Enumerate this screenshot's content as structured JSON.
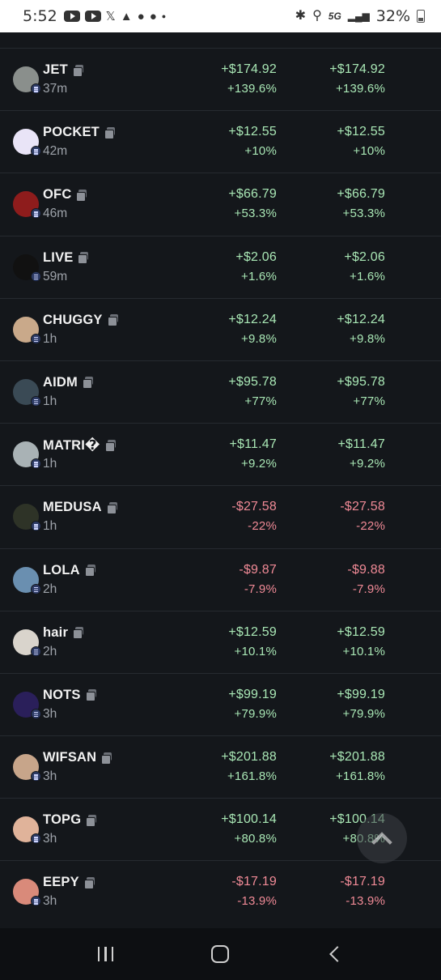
{
  "status_bar": {
    "time": "5:52",
    "network": "5G",
    "battery": "32%",
    "left_icons": [
      "youtube-icon",
      "youtube-icon",
      "x-icon",
      "arrow-app-icon",
      "reddit-icon",
      "reddit-icon",
      "dot-icon"
    ],
    "right_icons": [
      "bluetooth-icon",
      "location-icon",
      "5g-icon",
      "signal-icon",
      "battery-icon"
    ]
  },
  "rows": [
    {
      "name": "JET",
      "age": "37m",
      "val1": "+$174.92",
      "pct1": "+139.6%",
      "val2": "+$174.92",
      "pct2": "+139.6%",
      "trend": "pos",
      "avatar_color": "#8a8f8c"
    },
    {
      "name": "POCKET",
      "age": "42m",
      "val1": "+$12.55",
      "pct1": "+10%",
      "val2": "+$12.55",
      "pct2": "+10%",
      "trend": "pos",
      "avatar_color": "#e9e4f7"
    },
    {
      "name": "OFC",
      "age": "46m",
      "val1": "+$66.79",
      "pct1": "+53.3%",
      "val2": "+$66.79",
      "pct2": "+53.3%",
      "trend": "pos",
      "avatar_color": "#8e1c1c"
    },
    {
      "name": "LIVE",
      "age": "59m",
      "val1": "+$2.06",
      "pct1": "+1.6%",
      "val2": "+$2.06",
      "pct2": "+1.6%",
      "trend": "pos",
      "avatar_color": "#111111"
    },
    {
      "name": "CHUGGY",
      "age": "1h",
      "val1": "+$12.24",
      "pct1": "+9.8%",
      "val2": "+$12.24",
      "pct2": "+9.8%",
      "trend": "pos",
      "avatar_color": "#c9a98a"
    },
    {
      "name": "AIDM",
      "age": "1h",
      "val1": "+$95.78",
      "pct1": "+77%",
      "val2": "+$95.78",
      "pct2": "+77%",
      "trend": "pos",
      "avatar_color": "#3a4a55"
    },
    {
      "name": "MATRI�",
      "age": "1h",
      "val1": "+$11.47",
      "pct1": "+9.2%",
      "val2": "+$11.47",
      "pct2": "+9.2%",
      "trend": "pos",
      "avatar_color": "#a9b2b5"
    },
    {
      "name": "MEDUSA",
      "age": "1h",
      "val1": "-$27.58",
      "pct1": "-22%",
      "val2": "-$27.58",
      "pct2": "-22%",
      "trend": "neg",
      "avatar_color": "#2e3327"
    },
    {
      "name": "LOLA",
      "age": "2h",
      "val1": "-$9.87",
      "pct1": "-7.9%",
      "val2": "-$9.88",
      "pct2": "-7.9%",
      "trend": "neg",
      "avatar_color": "#6a8fb0"
    },
    {
      "name": "hair",
      "age": "2h",
      "val1": "+$12.59",
      "pct1": "+10.1%",
      "val2": "+$12.59",
      "pct2": "+10.1%",
      "trend": "pos",
      "avatar_color": "#d9d4cc"
    },
    {
      "name": "NOTS",
      "age": "3h",
      "val1": "+$99.19",
      "pct1": "+79.9%",
      "val2": "+$99.19",
      "pct2": "+79.9%",
      "trend": "pos",
      "avatar_color": "#2a1f5a"
    },
    {
      "name": "WIFSAN",
      "age": "3h",
      "val1": "+$201.88",
      "pct1": "+161.8%",
      "val2": "+$201.88",
      "pct2": "+161.8%",
      "trend": "pos",
      "avatar_color": "#c7a58a"
    },
    {
      "name": "TOPG",
      "age": "3h",
      "val1": "+$100.14",
      "pct1": "+80.8%",
      "val2": "+$100.14",
      "pct2": "+80.8%",
      "trend": "pos",
      "avatar_color": "#e0b39a"
    },
    {
      "name": "EEPY",
      "age": "3h",
      "val1": "-$17.19",
      "pct1": "-13.9%",
      "val2": "-$17.19",
      "pct2": "-13.9%",
      "trend": "neg",
      "avatar_color": "#d98a7a"
    }
  ],
  "colors": {
    "background": "#14171b",
    "positive": "#a9e7b5",
    "negative": "#f08a96",
    "divider": "#262a30"
  },
  "icons": {
    "scroll_top": "chevron-up-icon",
    "nav": [
      "recent-apps-icon",
      "home-icon",
      "back-icon"
    ]
  }
}
